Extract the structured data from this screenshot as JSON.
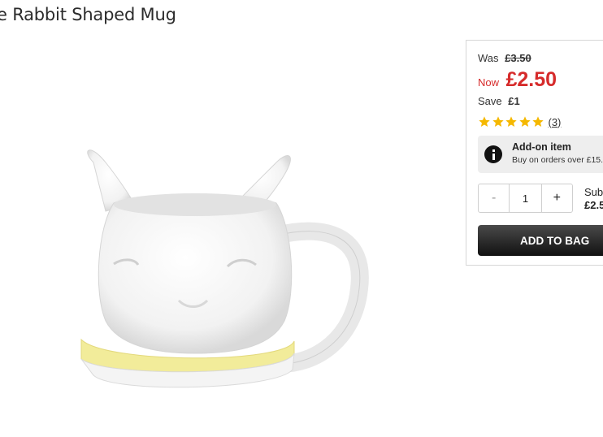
{
  "product": {
    "title": "e Rabbit Shaped Mug"
  },
  "pricing": {
    "was_label": "Was",
    "was_price": "£3.50",
    "now_label": "Now",
    "now_price": "£2.50",
    "save_label": "Save",
    "save_amount": "£1"
  },
  "rating": {
    "stars": 5,
    "review_count": "(3)"
  },
  "addon": {
    "title": "Add-on item",
    "subtitle": "Buy on orders over £15."
  },
  "quantity": {
    "decrement": "-",
    "value": "1",
    "increment": "+"
  },
  "subtotal": {
    "label": "Subt",
    "amount": "£2.5"
  },
  "actions": {
    "add_to_bag": "ADD TO BAG"
  },
  "colors": {
    "price_red": "#d62b2b",
    "star_gold": "#f5b800",
    "button_dark": "#1a1a1a"
  }
}
